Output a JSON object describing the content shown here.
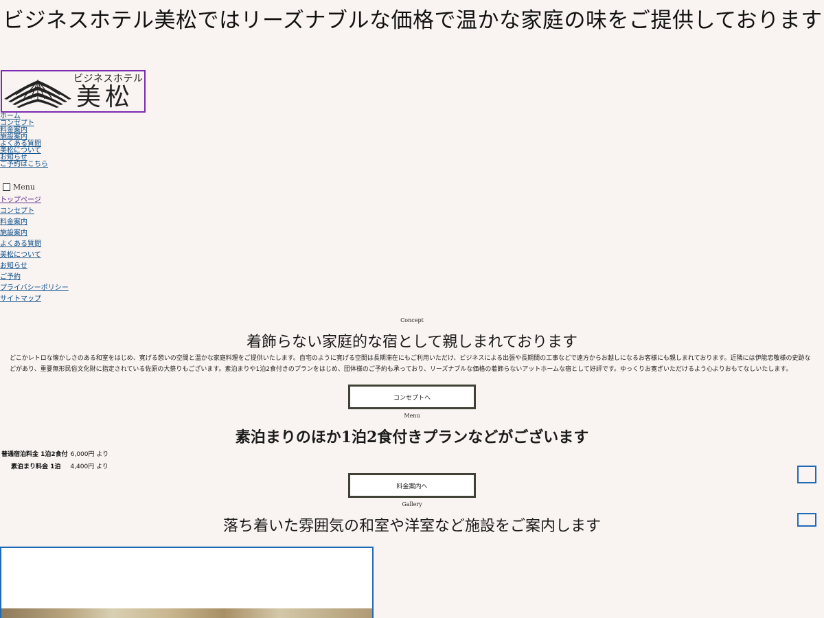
{
  "header": {
    "title": "ビジネスホテル美松ではリーズナブルな価格で温かな家庭の味をご提供しております"
  },
  "logo": {
    "subtitle": "ビジネスホテル",
    "name": "美松"
  },
  "top_nav": [
    {
      "label": "ホーム"
    },
    {
      "label": "コンセプト"
    },
    {
      "label": "料金案内"
    },
    {
      "label": "施設案内"
    },
    {
      "label": "よくある質問"
    },
    {
      "label": "美松について"
    },
    {
      "label": "お知らせ"
    },
    {
      "label": "ご予約はこちら"
    }
  ],
  "menu_toggle": {
    "label": "Menu"
  },
  "main_nav": [
    {
      "label": "トップページ"
    },
    {
      "label": "コンセプト"
    },
    {
      "label": "料金案内"
    },
    {
      "label": "施設案内"
    },
    {
      "label": "よくある質問"
    },
    {
      "label": "美松について"
    },
    {
      "label": "お知らせ"
    },
    {
      "label": "ご予約"
    },
    {
      "label": "プライバシーポリシー"
    },
    {
      "label": "サイトマップ"
    }
  ],
  "concept": {
    "label": "Concept",
    "heading": "着飾らない家庭的な宿として親しまれております",
    "body": "どこかレトロな懐かしさのある和室をはじめ、寛げる憩いの空間と温かな家庭料理をご提供いたします。自宅のように寛げる空間は長期滞在にもご利用いただけ、ビジネスによる出張や長期間の工事などで遠方からお越しになるお客様にも親しまれております。近隣には伊能忠敬様の史跡などがあり、重要無形民俗文化財に指定されている佐原の大祭りもございます。素泊まりや1泊2食付きのプランをはじめ、団体様のご予約も承っており、リーズナブルな価格の着飾らないアットホームな宿として好評です。ゆっくりお寛ぎいただけるよう心よりおもてなしいたします。",
    "button": "コンセプトへ"
  },
  "menu_section": {
    "label": "Menu",
    "heading": "素泊まりのほか1泊2食付きプランなどがございます",
    "prices": [
      {
        "name": "普通宿泊料金 1泊2食付",
        "amount": "6,000円 より"
      },
      {
        "name": "素泊まり料金 1泊",
        "amount": "4,400円 より"
      }
    ],
    "button": "料金案内へ"
  },
  "gallery": {
    "label": "Gallery",
    "heading": "落ち着いた雰囲気の和室や洋室など施設をご案内します"
  },
  "colors": {
    "background": "#f9f3f1",
    "link": "#0b4f8a",
    "visited_link": "#5a2b8a",
    "button_border": "#3f4234",
    "frame_border": "#1f6ab7",
    "logo_border": "#7b2ab3"
  },
  "icons": {
    "logo_mark": "pine-tree-icon",
    "menu_toggle": "checkbox-icon"
  }
}
